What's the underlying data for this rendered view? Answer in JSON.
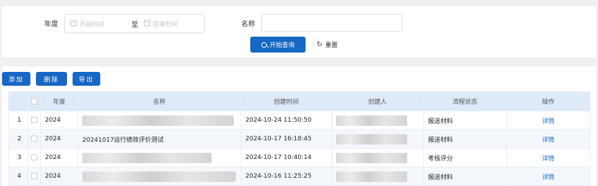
{
  "search": {
    "year_label": "年度",
    "start_placeholder": "开始时间",
    "range_sep": "至",
    "end_placeholder": "结束时间",
    "name_label": "名称",
    "name_value": "",
    "search_button": "开始查询",
    "reset_button": "重置"
  },
  "toolbar": {
    "add": "添加",
    "delete": "删除",
    "export": "导出"
  },
  "table": {
    "headers": {
      "year": "年度",
      "name": "名称",
      "created_time": "创建时间",
      "creator": "创建人",
      "status": "流程状态",
      "action": "操作"
    },
    "rows": [
      {
        "idx": "1",
        "year": "2024",
        "name": "",
        "name_redacted": true,
        "created_time": "2024-10-24 11:50:50",
        "creator": "",
        "creator_redacted": true,
        "status": "报送材料",
        "action": "详情"
      },
      {
        "idx": "2",
        "year": "2024",
        "name": "20241017运行绩效评价测试",
        "name_redacted": false,
        "created_time": "2024-10-17 16:18:45",
        "creator": "",
        "creator_redacted": true,
        "status": "报送材料",
        "action": "详情"
      },
      {
        "idx": "3",
        "year": "2024",
        "name": "",
        "name_redacted": true,
        "created_time": "2024-10-17 10:40:14",
        "creator": "",
        "creator_redacted": true,
        "status": "考核评分",
        "action": "详情"
      },
      {
        "idx": "4",
        "year": "2024",
        "name": "",
        "name_redacted": true,
        "created_time": "2024-10-16 11:25:25",
        "creator": "",
        "creator_redacted": true,
        "status": "报送材料",
        "action": "详情"
      }
    ]
  },
  "colors": {
    "primary": "#1767c4",
    "header_bg": "#dfeaf8",
    "page_bg": "#f0f0f0"
  }
}
